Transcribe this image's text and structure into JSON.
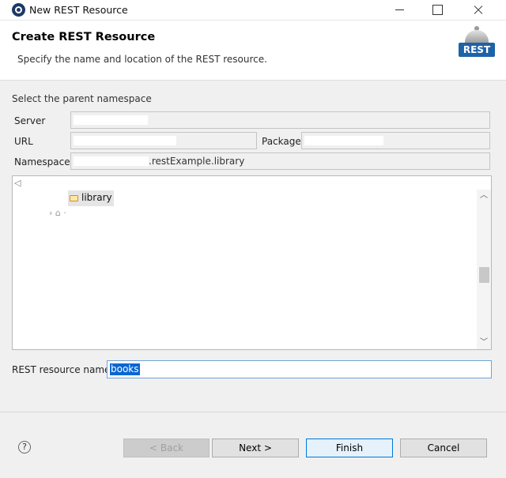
{
  "window": {
    "title": "New REST Resource"
  },
  "banner": {
    "title": "Create REST Resource",
    "subtitle": "Specify the name and location of the REST resource.",
    "logo_text": "REST"
  },
  "form": {
    "section_label": "Select the parent namespace",
    "server_label": "Server",
    "url_label": "URL",
    "package_label": "Package",
    "namespace_label": "Namespace",
    "namespace_value_suffix": ".restExample.library"
  },
  "tree": {
    "selected_item_label": "library"
  },
  "resource": {
    "label": "REST resource name",
    "value": "books"
  },
  "buttons": {
    "help": "?",
    "back": "< Back",
    "next": "Next >",
    "finish": "Finish",
    "cancel": "Cancel"
  },
  "colors": {
    "selection": "#0a66d3",
    "logo_blue": "#1e62a8",
    "default_button_border": "#0078d7"
  }
}
